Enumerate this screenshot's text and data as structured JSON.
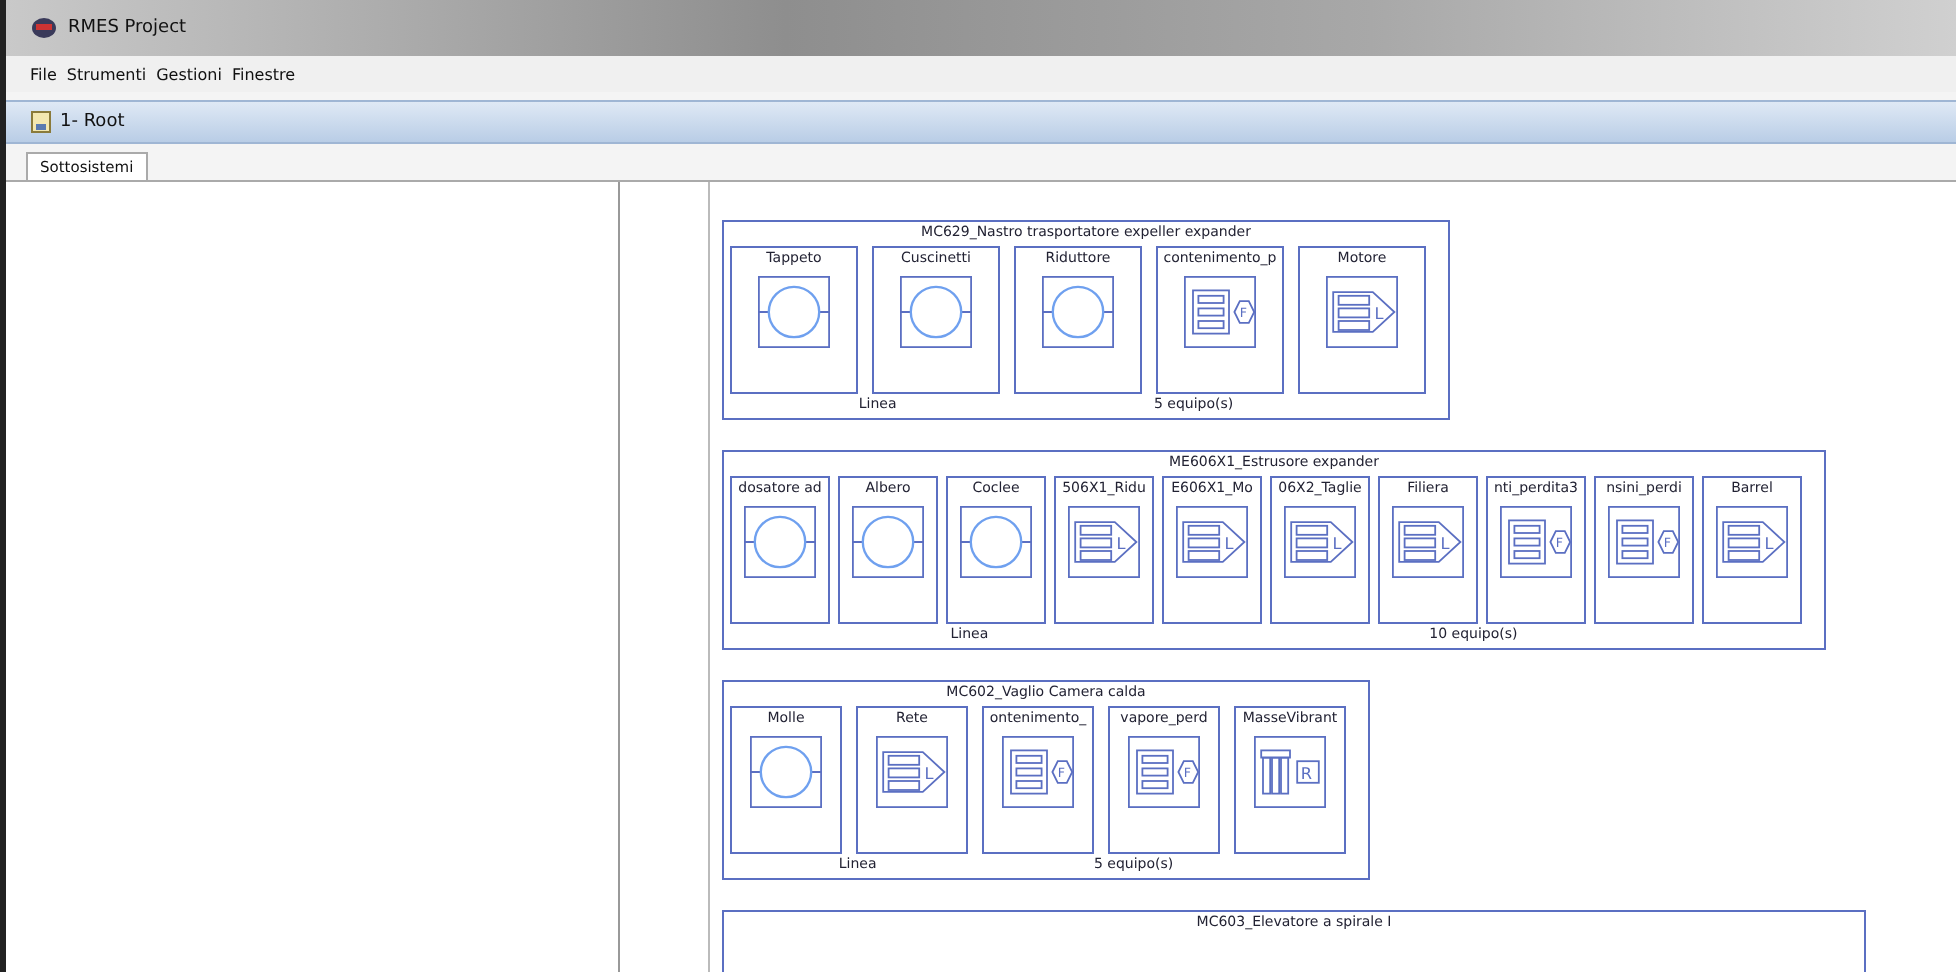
{
  "window": {
    "title": "RMES Project"
  },
  "menu": [
    "File",
    "Strumenti",
    "Gestioni",
    "Finestre"
  ],
  "inner_window": {
    "title": "1- Root"
  },
  "tabs": [
    {
      "label": "Sottosistemi",
      "selected": true
    }
  ],
  "groups": [
    {
      "title": "MC629_Nastro trasportatore expeller expander",
      "footer_left": "Linea",
      "footer_right": "5  equipo(s)",
      "items": [
        {
          "label": "Tappeto",
          "kind": "motor"
        },
        {
          "label": "Cuscinetti",
          "kind": "motor"
        },
        {
          "label": "Riduttore",
          "kind": "motor"
        },
        {
          "label": "contenimento_p",
          "kind": "filter",
          "symbol": "F"
        },
        {
          "label": "Motore",
          "kind": "line",
          "symbol": "L"
        }
      ]
    },
    {
      "title": "ME606X1_Estrusore expander",
      "footer_left": "Linea",
      "footer_right": "10  equipo(s)",
      "items": [
        {
          "label": "dosatore ad",
          "kind": "motor"
        },
        {
          "label": "Albero",
          "kind": "motor"
        },
        {
          "label": "Coclee",
          "kind": "motor"
        },
        {
          "label": "506X1_Ridu",
          "kind": "line",
          "symbol": "L"
        },
        {
          "label": "E606X1_Mo",
          "kind": "line",
          "symbol": "L"
        },
        {
          "label": "06X2_Taglie",
          "kind": "line",
          "symbol": "L"
        },
        {
          "label": "Filiera",
          "kind": "line",
          "symbol": "L"
        },
        {
          "label": "nti_perdita3",
          "kind": "filter",
          "symbol": "F"
        },
        {
          "label": "nsini_perdi",
          "kind": "filter",
          "symbol": "F"
        },
        {
          "label": "Barrel",
          "kind": "line",
          "symbol": "L"
        }
      ]
    },
    {
      "title": "MC602_Vaglio Camera calda",
      "footer_left": "Linea",
      "footer_right": "5  equipo(s)",
      "items": [
        {
          "label": "Molle",
          "kind": "motor"
        },
        {
          "label": "Rete",
          "kind": "line",
          "symbol": "L"
        },
        {
          "label": "ontenimento_",
          "kind": "filter",
          "symbol": "F"
        },
        {
          "label": "vapore_perd",
          "kind": "filter",
          "symbol": "F"
        },
        {
          "label": "MasseVibrant",
          "kind": "rack",
          "symbol": "R"
        }
      ]
    },
    {
      "title": "MC603_Elevatore a spirale I"
    }
  ]
}
